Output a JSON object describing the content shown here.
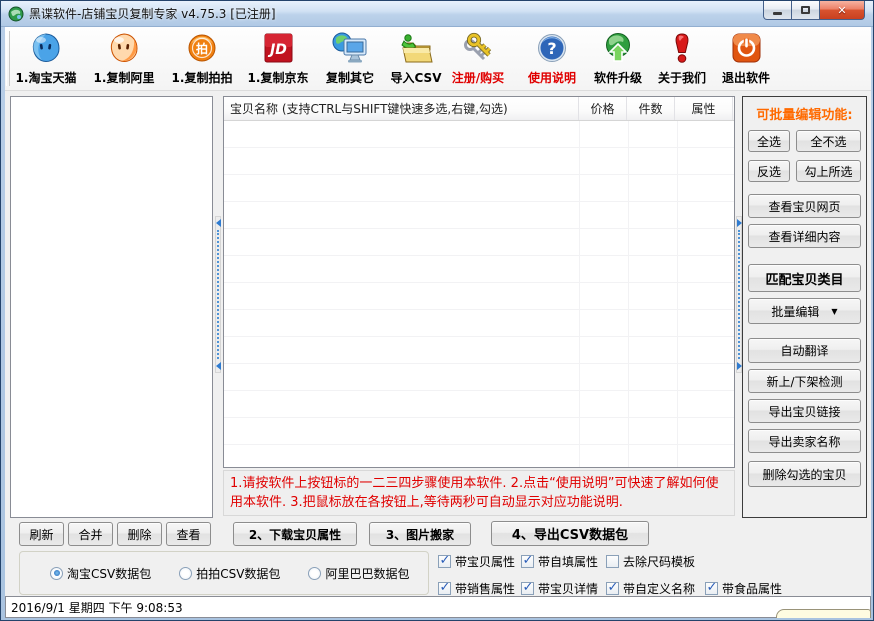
{
  "window": {
    "title": "黑谍软件-店铺宝贝复制专家  v4.75.3 [已注册]",
    "close_glyph": "✕"
  },
  "colors": {
    "accent_orange": "#ff6a00",
    "warning_red": "#e00000",
    "titlebar_blue": "#bcd2ea"
  },
  "toolbar": {
    "items": [
      {
        "label": "1.淘宝天猫",
        "icon": "taobao-wangwang-icon"
      },
      {
        "label": "1.复制阿里",
        "icon": "ali-wangwang-icon"
      },
      {
        "label": "1.复制拍拍",
        "icon": "paipai-icon"
      },
      {
        "label": "1.复制京东",
        "icon": "jd-icon"
      },
      {
        "label": "复制其它",
        "icon": "globe-monitor-icon"
      },
      {
        "label": "导入CSV",
        "icon": "folder-import-icon"
      },
      {
        "label": "注册/购买",
        "icon": "keys-icon"
      },
      {
        "label": "使用说明",
        "icon": "question-icon"
      },
      {
        "label": "软件升级",
        "icon": "globe-up-arrow-icon"
      },
      {
        "label": "关于我们",
        "icon": "exclamation-icon"
      },
      {
        "label": "退出软件",
        "icon": "power-icon"
      }
    ],
    "paipai_glyph": "拍",
    "jd_glyph": "JD"
  },
  "list": {
    "columns": {
      "name": "宝贝名称 (支持CTRL与SHIFT键快速多选,右键,勾选)",
      "price": "价格",
      "qty": "件数",
      "attr": "属性"
    },
    "instructions": "1.请按软件上按钮标的一二三四步骤使用本软件.  2.点击“使用说明”可快速了解如何使用本软件.  3.把鼠标放在各按钮上,等待两秒可自动显示对应功能说明."
  },
  "sidebar": {
    "title": "可批量编辑功能:",
    "select_all": "全选",
    "select_none": "全不选",
    "invert": "反选",
    "check_selected": "勾上所选",
    "view_page": "查看宝贝网页",
    "view_detail": "查看详细内容",
    "match_category": "匹配宝贝类目",
    "batch_edit": "批量编辑",
    "batch_edit_arrow": "▼",
    "auto_translate": "自动翻译",
    "shelf_check": "新上/下架检测",
    "export_links": "导出宝贝链接",
    "export_sellers": "导出卖家名称",
    "delete_checked": "删除勾选的宝贝"
  },
  "bottom": {
    "refresh": "刷新",
    "merge": "合并",
    "delete": "删除",
    "view": "查看",
    "step2": "2、下载宝贝属性",
    "step3": "3、图片搬家",
    "step4": "4、导出CSV数据包",
    "radios": [
      {
        "label": "淘宝CSV数据包",
        "selected": true
      },
      {
        "label": "拍拍CSV数据包",
        "selected": false
      },
      {
        "label": "阿里巴巴数据包",
        "selected": false
      }
    ],
    "checkboxes": [
      {
        "label": "带宝贝属性",
        "checked": true
      },
      {
        "label": "带自填属性",
        "checked": true
      },
      {
        "label": "去除尺码模板",
        "checked": false
      },
      {
        "label": "带销售属性",
        "checked": true
      },
      {
        "label": "带宝贝详情",
        "checked": true
      },
      {
        "label": "带自定义名称",
        "checked": true
      },
      {
        "label": "带食品属性",
        "checked": true
      }
    ]
  },
  "statusbar": {
    "datetime": "2016/9/1 星期四 下午 9:08:53"
  }
}
